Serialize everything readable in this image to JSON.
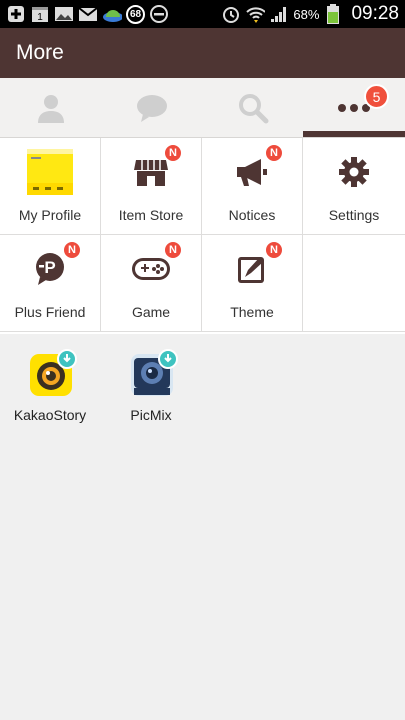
{
  "status_bar": {
    "notif_count": "68",
    "battery": "68%",
    "time": "09:28"
  },
  "header": {
    "title": "More"
  },
  "tabs": {
    "items": [
      {
        "icon": "person-icon"
      },
      {
        "icon": "chat-bubble-icon"
      },
      {
        "icon": "search-icon"
      },
      {
        "icon": "more-dots-icon",
        "badge": "5",
        "active": true
      }
    ]
  },
  "menu": {
    "items": [
      {
        "label": "My Profile",
        "icon": "profile-card-icon",
        "new": false
      },
      {
        "label": "Item Store",
        "icon": "store-icon",
        "new": true,
        "badge": "N"
      },
      {
        "label": "Notices",
        "icon": "megaphone-icon",
        "new": true,
        "badge": "N"
      },
      {
        "label": "Settings",
        "icon": "gear-icon",
        "new": false
      },
      {
        "label": "Plus Friend",
        "icon": "plus-friend-icon",
        "new": true,
        "badge": "N"
      },
      {
        "label": "Game",
        "icon": "gamepad-icon",
        "new": true,
        "badge": "N"
      },
      {
        "label": "Theme",
        "icon": "theme-brush-icon",
        "new": true,
        "badge": "N"
      }
    ]
  },
  "apps": {
    "items": [
      {
        "label": "KakaoStory",
        "icon": "kakaostory-icon"
      },
      {
        "label": "PicMix",
        "icon": "picmix-icon"
      }
    ]
  },
  "colors": {
    "header_bg": "#4e3533",
    "badge_red": "#f0503c",
    "download_teal": "#3fc3c0"
  }
}
